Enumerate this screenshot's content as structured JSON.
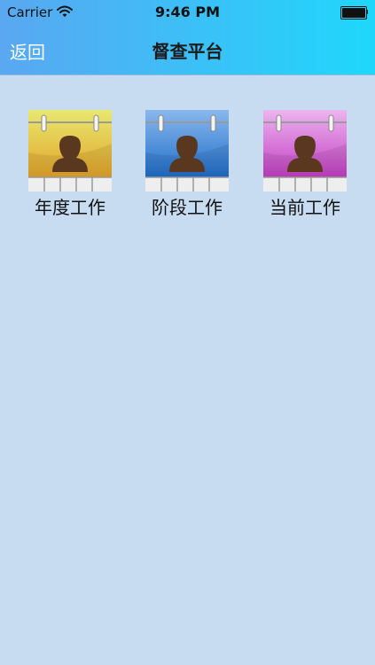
{
  "status_bar": {
    "carrier": "Carrier",
    "time": "9:46 PM",
    "wifi_icon": "wifi-icon",
    "battery_icon": "battery-icon",
    "battery_level": 1.0
  },
  "nav": {
    "back_label": "返回",
    "title": "督查平台",
    "gradient_start": "#5aa7f2",
    "gradient_end": "#1fd7fb"
  },
  "background_color": "#c7dbf1",
  "tiles": [
    {
      "label": "年度工作",
      "icon": "contact-calendar-icon",
      "top_color": "#e8e870",
      "bottom_color": "#e3a52a"
    },
    {
      "label": "阶段工作",
      "icon": "contact-calendar-icon",
      "top_color": "#8ab8ec",
      "bottom_color": "#1f6ecb"
    },
    {
      "label": "当前工作",
      "icon": "contact-calendar-icon",
      "top_color": "#ecb4ef",
      "bottom_color": "#c440c4"
    }
  ]
}
